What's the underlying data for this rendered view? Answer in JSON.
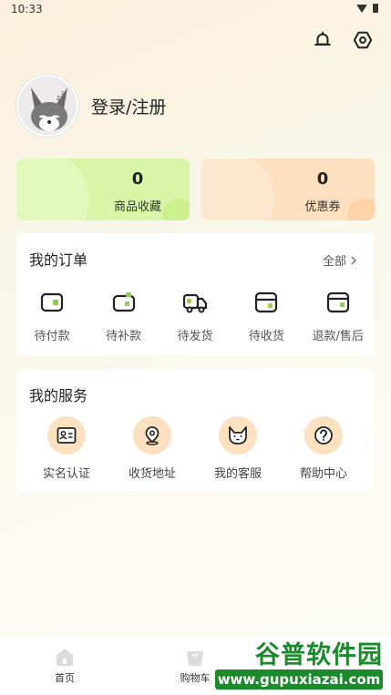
{
  "status_bar": {
    "time": "10:33",
    "wifi_icon": "wifi-icon",
    "battery_icon": "battery-icon"
  },
  "header": {
    "notification_icon": "bell-icon",
    "settings_icon": "hexagon-settings-icon"
  },
  "profile": {
    "login_label": "登录/注册",
    "avatar_icon": "fox-avatar-icon"
  },
  "stats": [
    {
      "value": "0",
      "label": "商品收藏",
      "color": "#d9f6a8"
    },
    {
      "value": "0",
      "label": "优惠券",
      "color": "#fde0bf"
    }
  ],
  "orders": {
    "title": "我的订单",
    "more_label": "全部",
    "items": [
      {
        "label": "待付款",
        "icon": "wallet-icon"
      },
      {
        "label": "待补款",
        "icon": "wallet-add-icon"
      },
      {
        "label": "待发货",
        "icon": "truck-icon"
      },
      {
        "label": "待收货",
        "icon": "box-icon"
      },
      {
        "label": "退款/售后",
        "icon": "card-refund-icon"
      }
    ]
  },
  "services": {
    "title": "我的服务",
    "items": [
      {
        "label": "实名认证",
        "icon": "id-card-icon"
      },
      {
        "label": "收货地址",
        "icon": "location-pin-icon"
      },
      {
        "label": "我的客服",
        "icon": "fox-face-icon"
      },
      {
        "label": "帮助中心",
        "icon": "question-icon"
      }
    ]
  },
  "tabbar": {
    "tabs": [
      {
        "label": "首页",
        "icon": "home-icon"
      },
      {
        "label": "购物车",
        "icon": "cart-bag-icon"
      }
    ]
  },
  "watermark": {
    "title": "谷普软件园",
    "url": "www.gupuxiazai.com"
  },
  "colors": {
    "accent_green": "#8fd14f",
    "accent_orange": "#fde0bf",
    "watermark_green": "#1a8a2a"
  }
}
